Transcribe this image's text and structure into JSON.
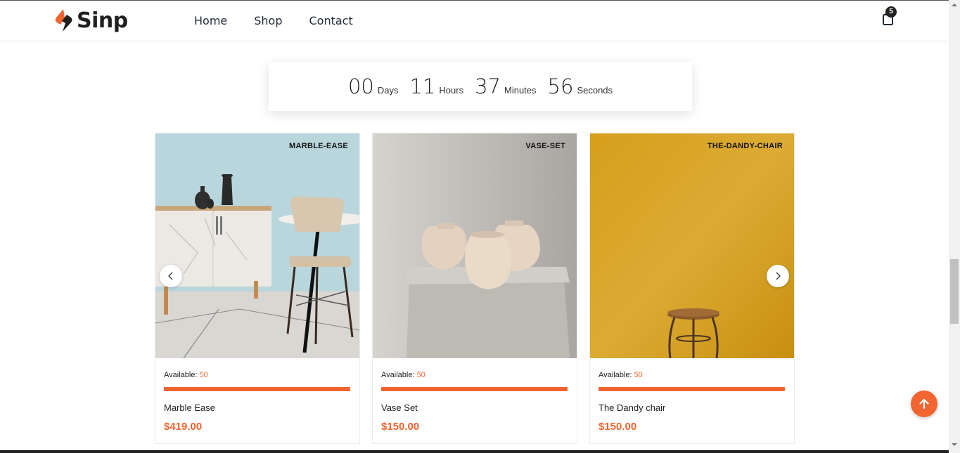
{
  "header": {
    "logo_text": "Sinp",
    "nav": [
      "Home",
      "Shop",
      "Contact"
    ],
    "cart_count": "5"
  },
  "countdown": {
    "days": "00",
    "days_label": "Days",
    "hours": "11",
    "hours_label": "Hours",
    "minutes": "37",
    "minutes_label": "Minutes",
    "seconds": "56",
    "seconds_label": "Seconds"
  },
  "products": [
    {
      "tag": "MARBLE-EASE",
      "available_label": "Available:",
      "available": "50",
      "name": "Marble Ease",
      "price": "$419.00",
      "stock_fraction": 1.0
    },
    {
      "tag": "VASE-SET",
      "available_label": "Available:",
      "available": "50",
      "name": "Vase Set",
      "price": "$150.00",
      "stock_fraction": 1.0
    },
    {
      "tag": "THE-DANDY-CHAIR",
      "available_label": "Available:",
      "available": "50",
      "name": "The Dandy chair",
      "price": "$150.00",
      "stock_fraction": 1.0
    }
  ],
  "colors": {
    "accent": "#f26430",
    "text": "#222222",
    "nav": "#1e2a38"
  },
  "icons": {
    "cart": "shopping-bag-icon",
    "prev": "chevron-left-icon",
    "next": "chevron-right-icon",
    "scroll_top": "arrow-up-icon"
  }
}
